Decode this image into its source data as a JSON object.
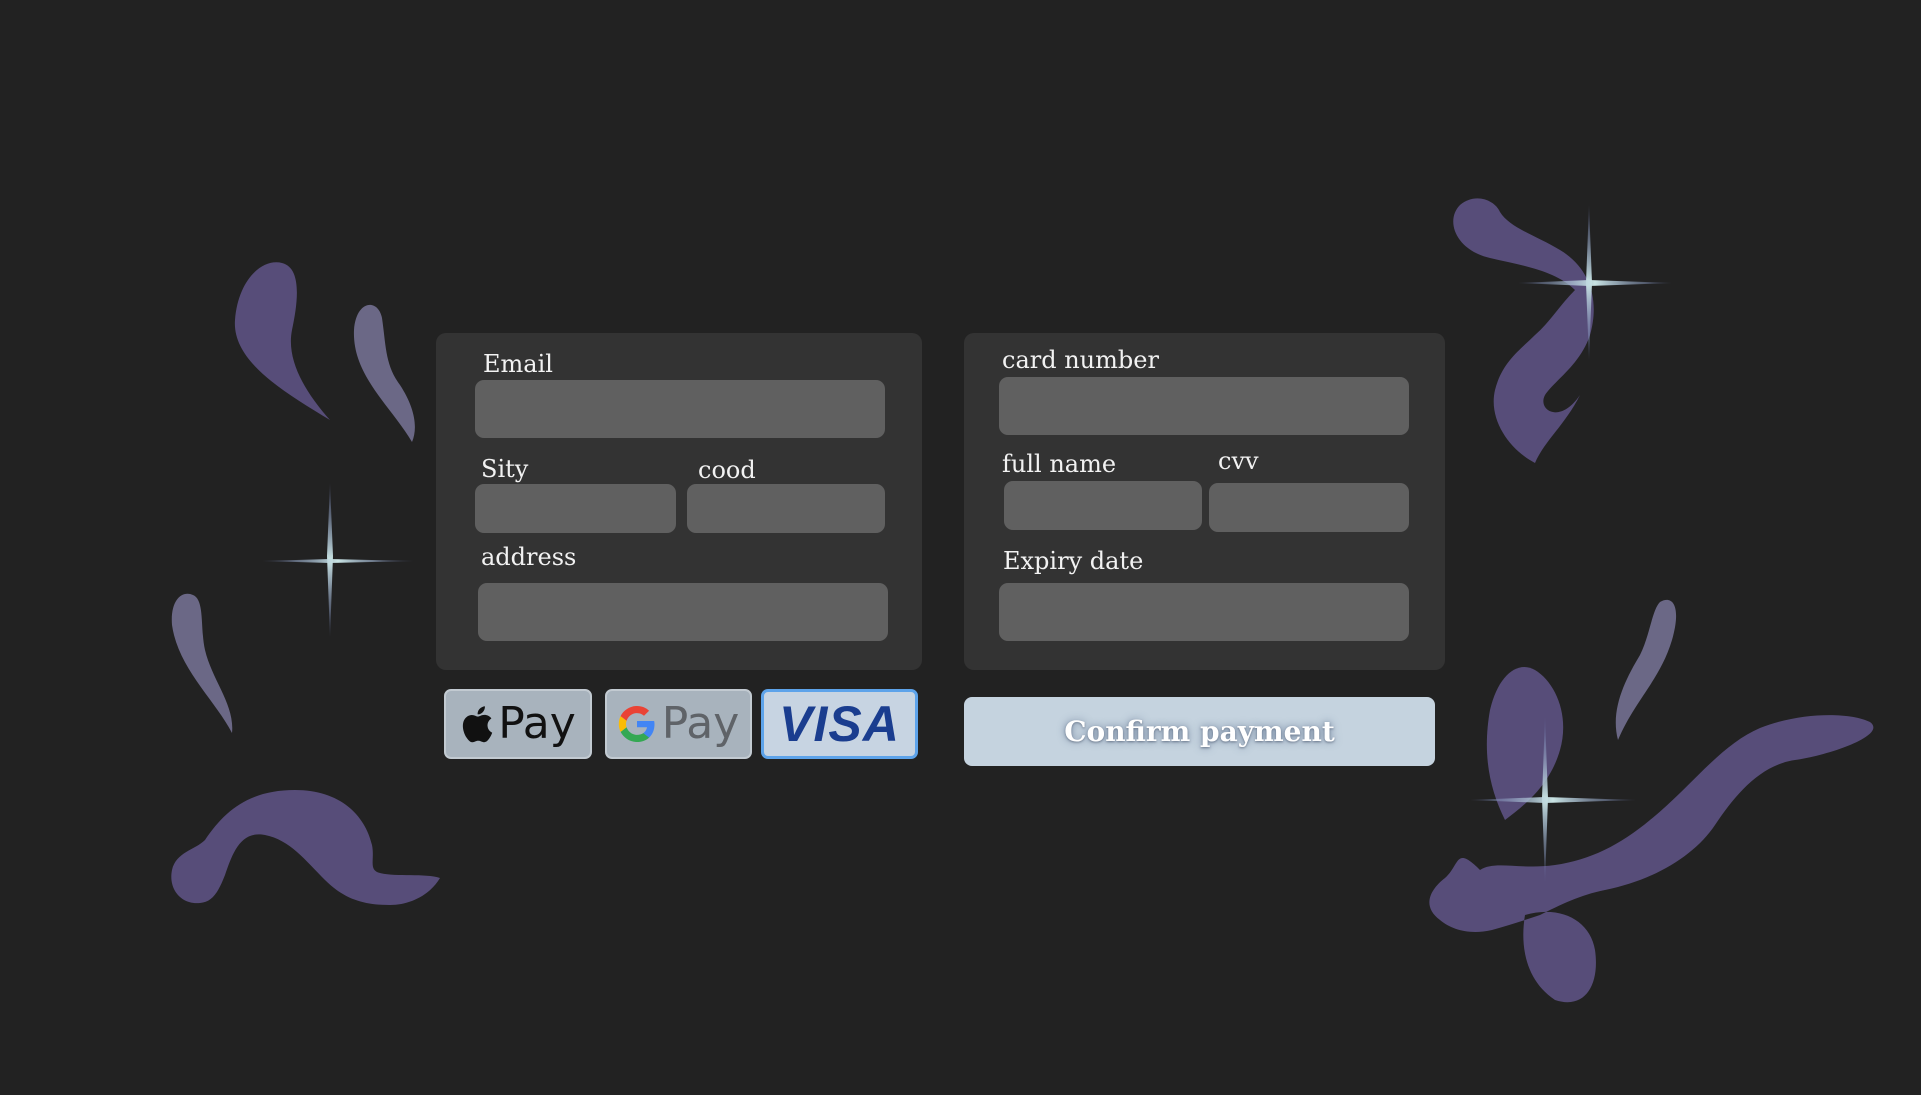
{
  "form_left": {
    "email": {
      "label": "Email",
      "value": "",
      "placeholder": ""
    },
    "city": {
      "label": "Sity",
      "value": "",
      "placeholder": ""
    },
    "code": {
      "label": "cood",
      "value": "",
      "placeholder": ""
    },
    "address": {
      "label": "address",
      "value": "",
      "placeholder": ""
    }
  },
  "form_right": {
    "card_number": {
      "label": "card number",
      "value": "",
      "placeholder": ""
    },
    "full_name": {
      "label": "full name",
      "value": "",
      "placeholder": ""
    },
    "cvv": {
      "label": "cvv",
      "value": "",
      "placeholder": ""
    },
    "expiry": {
      "label": "Expiry date",
      "value": "",
      "placeholder": ""
    }
  },
  "payment_methods": {
    "apple_pay": {
      "icon": "apple-icon",
      "label": "Pay"
    },
    "google_pay": {
      "icon": "google-g-icon",
      "label": "Pay"
    },
    "visa": {
      "label": "VISA",
      "selected": true
    }
  },
  "confirm": {
    "label": "Confirm payment"
  },
  "colors": {
    "background": "#222222",
    "panel": "#333333",
    "field": "#606060",
    "decoration": "#5a507a",
    "selected_outline": "#5da3ea",
    "confirm_bg": "#c5d3df"
  }
}
